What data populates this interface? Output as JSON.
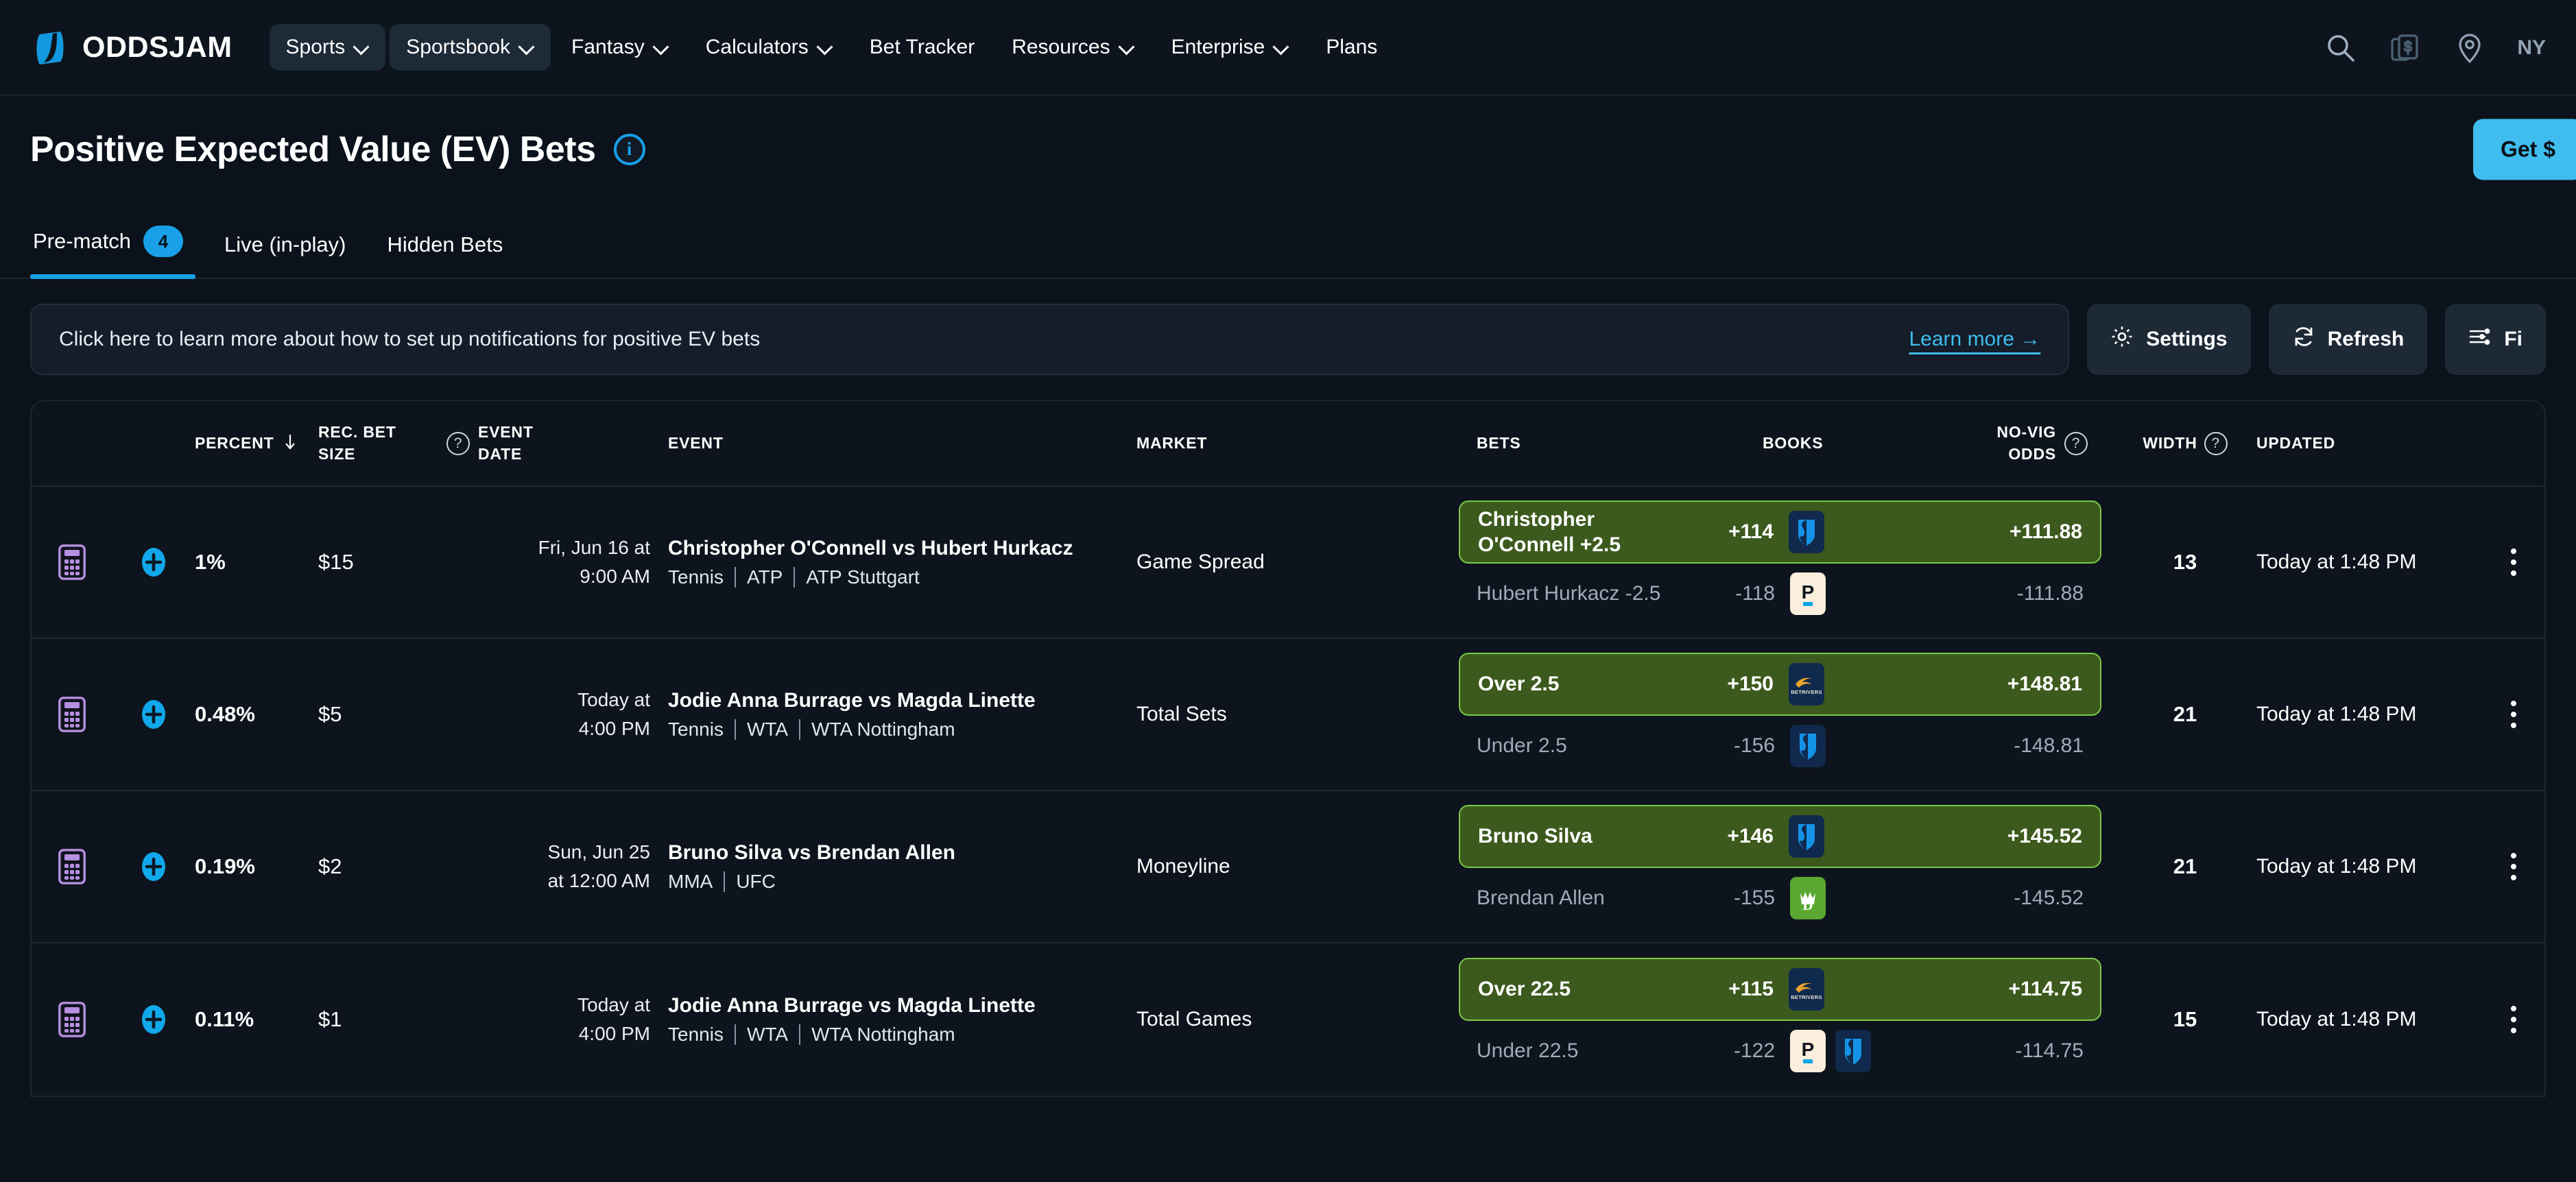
{
  "brand": {
    "name": "ODDSJAM",
    "logo_icon": "oddsjam-logo-icon"
  },
  "nav": {
    "items": [
      {
        "label": "Sports",
        "has_caret": true,
        "active": false
      },
      {
        "label": "Sportsbook",
        "has_caret": true,
        "active": true
      },
      {
        "label": "Fantasy",
        "has_caret": true,
        "active": false
      },
      {
        "label": "Calculators",
        "has_caret": true,
        "active": false
      },
      {
        "label": "Bet Tracker",
        "has_caret": false,
        "active": false
      },
      {
        "label": "Resources",
        "has_caret": true,
        "active": false
      },
      {
        "label": "Enterprise",
        "has_caret": true,
        "active": false
      },
      {
        "label": "Plans",
        "has_caret": false,
        "active": false
      }
    ],
    "right": {
      "search_icon": "search-icon",
      "bets_icon": "bet-cards-dollar-icon",
      "location_icon": "location-pin-icon",
      "state": "NY"
    }
  },
  "header": {
    "title": "Positive Expected Value (EV) Bets",
    "info_icon": "info-icon",
    "info_glyph": "i",
    "cta_label": "Get $"
  },
  "tabs": [
    {
      "label": "Pre-match",
      "badge": "4",
      "active": true
    },
    {
      "label": "Live (in-play)",
      "badge": "",
      "active": false
    },
    {
      "label": "Hidden Bets",
      "badge": "",
      "active": false
    }
  ],
  "notice": {
    "text": "Click here to learn more about how to set up notifications for positive EV bets",
    "link_label": "Learn more →"
  },
  "actions": [
    {
      "label": "Settings",
      "icon": "gear-icon"
    },
    {
      "label": "Refresh",
      "icon": "refresh-icon"
    },
    {
      "label": "Fi",
      "icon": "filters-icon"
    }
  ],
  "table": {
    "columns": {
      "percent": "Percent",
      "sort_icon": "sort-desc-arrow-icon",
      "rec_bet_size_line1": "Rec. Bet",
      "rec_bet_size_line2": "Size",
      "help_icon": "question-mark-icon",
      "event_date_line1": "Event",
      "event_date_line2": "Date",
      "event": "Event",
      "market": "Market",
      "bets": "Bets",
      "books": "Books",
      "no_vig_line1": "No-Vig",
      "no_vig_line2": "Odds",
      "width": "Width",
      "updated": "Updated"
    },
    "rows": [
      {
        "calc_icon": "calculator-icon",
        "add_icon": "add-to-betslip-icon",
        "percent": "1%",
        "rec_bet_size": "$15",
        "event_date_line1": "Fri, Jun 16 at",
        "event_date_line2": "9:00 AM",
        "event_title": "Christopher O'Connell vs Hubert Hurkacz",
        "event_sport": "Tennis",
        "event_league": "ATP",
        "event_competition": "ATP Stuttgart",
        "market": "Game Spread",
        "primary_bet": {
          "name": "Christopher O'Connell +2.5",
          "odds": "+114",
          "no_vig": "+111.88",
          "books": [
            "fanduel"
          ]
        },
        "secondary_bet": {
          "name": "Hubert Hurkacz -2.5",
          "odds": "-118",
          "no_vig": "-111.88",
          "books": [
            "pinnacle"
          ]
        },
        "width": "13",
        "updated": "Today at 1:48 PM",
        "menu_icon": "kebab-menu-icon"
      },
      {
        "calc_icon": "calculator-icon",
        "add_icon": "add-to-betslip-icon",
        "percent": "0.48%",
        "rec_bet_size": "$5",
        "event_date_line1": "Today at",
        "event_date_line2": "4:00 PM",
        "event_title": "Jodie Anna Burrage vs Magda Linette",
        "event_sport": "Tennis",
        "event_league": "WTA",
        "event_competition": "WTA Nottingham",
        "market": "Total Sets",
        "primary_bet": {
          "name": "Over 2.5",
          "odds": "+150",
          "no_vig": "+148.81",
          "books": [
            "betrivers"
          ]
        },
        "secondary_bet": {
          "name": "Under 2.5",
          "odds": "-156",
          "no_vig": "-148.81",
          "books": [
            "fanduel"
          ]
        },
        "width": "21",
        "updated": "Today at 1:48 PM",
        "menu_icon": "kebab-menu-icon"
      },
      {
        "calc_icon": "calculator-icon",
        "add_icon": "add-to-betslip-icon",
        "percent": "0.19%",
        "rec_bet_size": "$2",
        "event_date_line1": "Sun, Jun 25",
        "event_date_line2": "at 12:00 AM",
        "event_title": "Bruno Silva vs Brendan Allen",
        "event_sport": "MMA",
        "event_league": "UFC",
        "event_competition": "",
        "market": "Moneyline",
        "primary_bet": {
          "name": "Bruno Silva",
          "odds": "+146",
          "no_vig": "+145.52",
          "books": [
            "fanduel"
          ]
        },
        "secondary_bet": {
          "name": "Brendan Allen",
          "odds": "-155",
          "no_vig": "-145.52",
          "books": [
            "draftkings"
          ]
        },
        "width": "21",
        "updated": "Today at 1:48 PM",
        "menu_icon": "kebab-menu-icon"
      },
      {
        "calc_icon": "calculator-icon",
        "add_icon": "add-to-betslip-icon",
        "percent": "0.11%",
        "rec_bet_size": "$1",
        "event_date_line1": "Today at",
        "event_date_line2": "4:00 PM",
        "event_title": "Jodie Anna Burrage vs Magda Linette",
        "event_sport": "Tennis",
        "event_league": "WTA",
        "event_competition": "WTA Nottingham",
        "market": "Total Games",
        "primary_bet": {
          "name": "Over 22.5",
          "odds": "+115",
          "no_vig": "+114.75",
          "books": [
            "betrivers"
          ]
        },
        "secondary_bet": {
          "name": "Under 22.5",
          "odds": "-122",
          "no_vig": "-114.75",
          "books": [
            "pinnacle",
            "fanduel"
          ]
        },
        "width": "15",
        "updated": "Today at 1:48 PM",
        "menu_icon": "kebab-menu-icon"
      }
    ]
  },
  "colors": {
    "page_bg": "#0c121b",
    "nav_bg": "#0e141d",
    "accent_blue": "#18a0e8",
    "cta_blue": "#3fbdee",
    "positive_bet_bg": "#3c5a1d",
    "positive_bet_border": "#7bc94a",
    "muted_text": "#9fabb9",
    "calc_icon_purple": "#b68fe0"
  }
}
